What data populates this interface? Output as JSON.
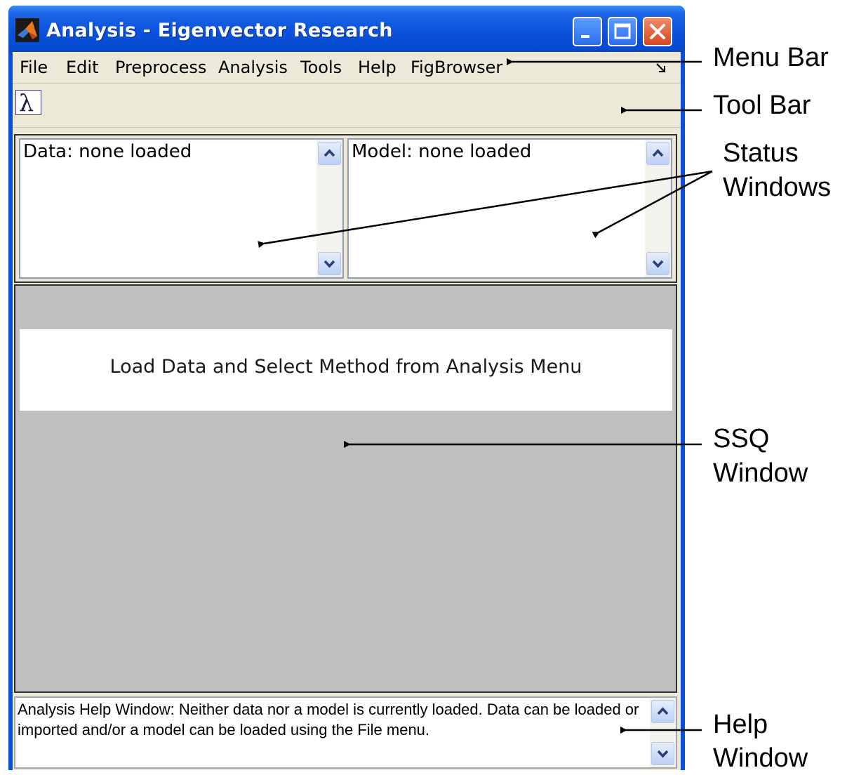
{
  "window": {
    "title": "Analysis - Eigenvector Research",
    "icon": "matlab-logo-icon",
    "controls": [
      "minimize-icon",
      "maximize-icon",
      "close-icon"
    ]
  },
  "menubar": {
    "items": [
      "File",
      "Edit",
      "Preprocess",
      "Analysis",
      "Tools",
      "Help",
      "FigBrowser"
    ]
  },
  "toolbar": {
    "buttons": [
      {
        "icon": "lambda-icon",
        "glyph": "λ"
      }
    ]
  },
  "status": {
    "data": "Data: none loaded",
    "model": "Model: none loaded"
  },
  "ssq": {
    "message": "Load Data and Select Method from Analysis Menu"
  },
  "help": {
    "text": "Analysis Help Window: Neither data nor a model is currently loaded. Data can be loaded or imported and/or a model can be loaded using the File menu."
  },
  "annotations": {
    "menu_bar": "Menu Bar",
    "tool_bar": "Tool Bar",
    "status_line1": "Status",
    "status_line2": "Windows",
    "ssq_line1": "SSQ",
    "ssq_line2": "Window",
    "help_line1": "Help",
    "help_line2": "Window"
  },
  "colors": {
    "titlebar": "#0a52dc",
    "client": "#ece9d8",
    "ssq_background": "#bfbfbf"
  }
}
